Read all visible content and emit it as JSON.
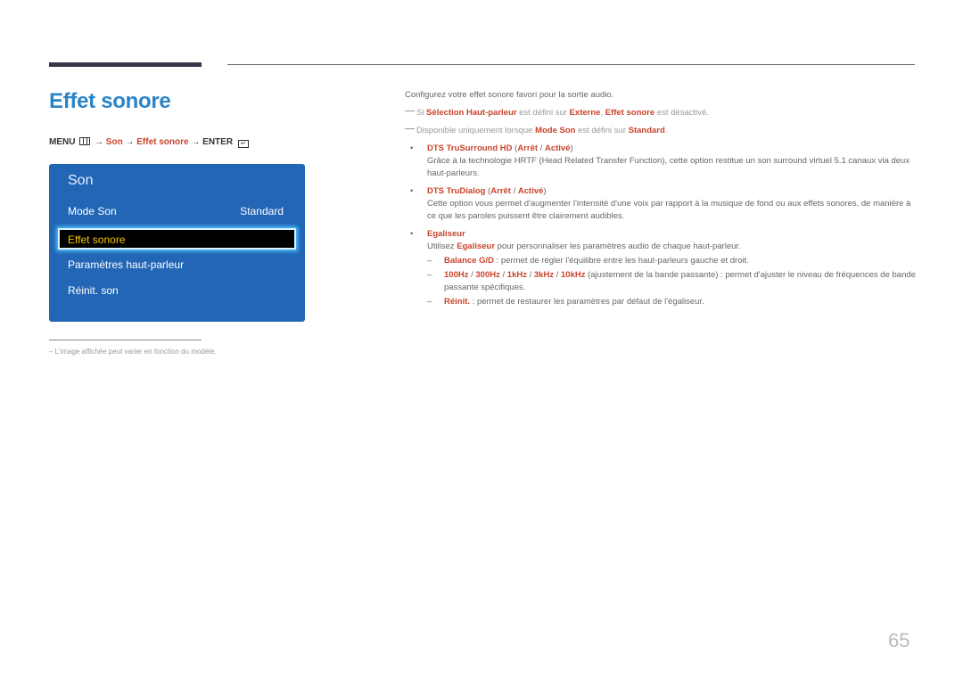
{
  "header": {
    "title": "Effet sonore"
  },
  "menu_path": {
    "menu_label": "MENU",
    "arrow": "→",
    "son": "Son",
    "effet": "Effet sonore",
    "enter_label": "ENTER",
    "enter_glyph": "↵"
  },
  "osd": {
    "title": "Son",
    "items": [
      {
        "label": "Mode Son",
        "value": "Standard"
      },
      {
        "label": "Effet sonore",
        "value": ""
      },
      {
        "label": "Paramètres haut-parleur",
        "value": ""
      },
      {
        "label": "Réinit. son",
        "value": ""
      }
    ],
    "colors": {
      "background": "#2266b5",
      "selected_text": "#f5c400",
      "highlight_border": "#4cc0ff"
    }
  },
  "footnote": "L'image affichée peut varier en fonction du modèle.",
  "content": {
    "intro": "Configurez votre effet sonore favori pour la sortie audio.",
    "note1": {
      "pre": "Si ",
      "a": "Sélection Haut-parleur",
      "mid1": " est défini sur ",
      "b": "Externe",
      "mid2": ", ",
      "c": "Effet sonore",
      "post": " est désactivé."
    },
    "note2": {
      "pre": "Disponible uniquement lorsque ",
      "a": "Mode Son",
      "mid": " est défini sur ",
      "b": "Standard",
      "post": "."
    },
    "b1": {
      "title": "DTS TruSurround HD",
      "open": " (",
      "opt1": "Arrêt",
      "sep": " / ",
      "opt2": "Activé",
      "close": ")",
      "desc": "Grâce à la technologie HRTF (Head Related Transfer Function), cette option restitue un son surround virtuel 5.1 canaux via deux haut-parleurs."
    },
    "b2": {
      "title": "DTS TruDialog",
      "open": " (",
      "opt1": "Arrêt",
      "sep": " / ",
      "opt2": "Activé",
      "close": ")",
      "desc": "Cette option vous permet d'augmenter l'intensité d'une voix par rapport à la musique de fond ou aux effets sonores, de manière à ce que les paroles puissent être clairement audibles."
    },
    "b3": {
      "title": "Egaliseur",
      "desc_pre": "Utilisez ",
      "desc_hl": "Egaliseur",
      "desc_post": " pour personnaliser les paramètres audio de chaque haut-parleur.",
      "sub1": {
        "hl": "Balance G/D",
        "text": " : permet de régler l'équilibre entre les haut-parleurs gauche et droit."
      },
      "sub2": {
        "f1": "100Hz",
        "f2": "300Hz",
        "f3": "1kHz",
        "f4": "3kHz",
        "f5": "10kHz",
        "sep": " / ",
        "text": " (ajustement de la bande passante) : permet d'ajuster le niveau de fréquences de bande passante spécifiques."
      },
      "sub3": {
        "hl": "Réinit.",
        "text": " : permet de restaurer les paramètres par défaut de l'égaliseur."
      }
    }
  },
  "page_number": "65",
  "colors": {
    "title": "#2b84c6",
    "highlight": "#c8442b"
  }
}
